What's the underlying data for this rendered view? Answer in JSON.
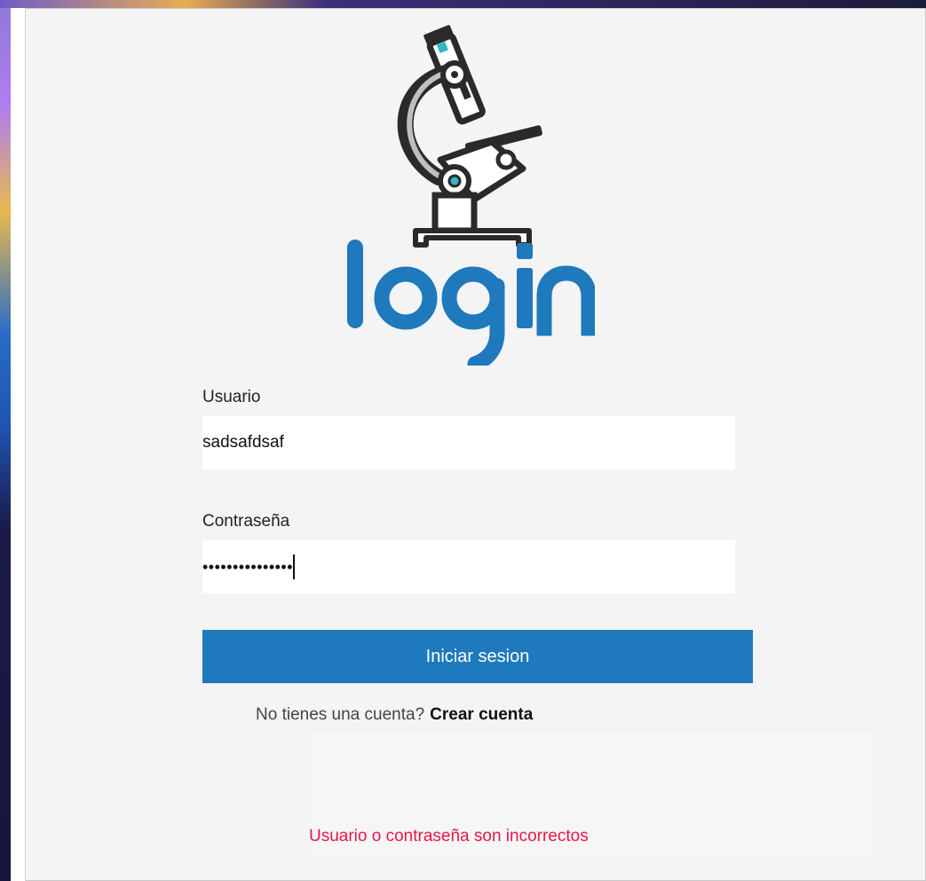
{
  "brand": {
    "logo_icon": "microscope-icon",
    "logo_text": "login",
    "accent_color": "#1e79bd"
  },
  "form": {
    "username_label": "Usuario",
    "username_value": "sadsafdsaf",
    "password_label": "Contraseña",
    "password_value": "•••••••••••••••",
    "submit_label": "Iniciar sesion"
  },
  "signup": {
    "prompt": "No tienes una cuenta?",
    "link_label": "Crear cuenta"
  },
  "status": {
    "error_message": "Usuario o contraseña son incorrectos",
    "error_color": "#e8164a"
  }
}
